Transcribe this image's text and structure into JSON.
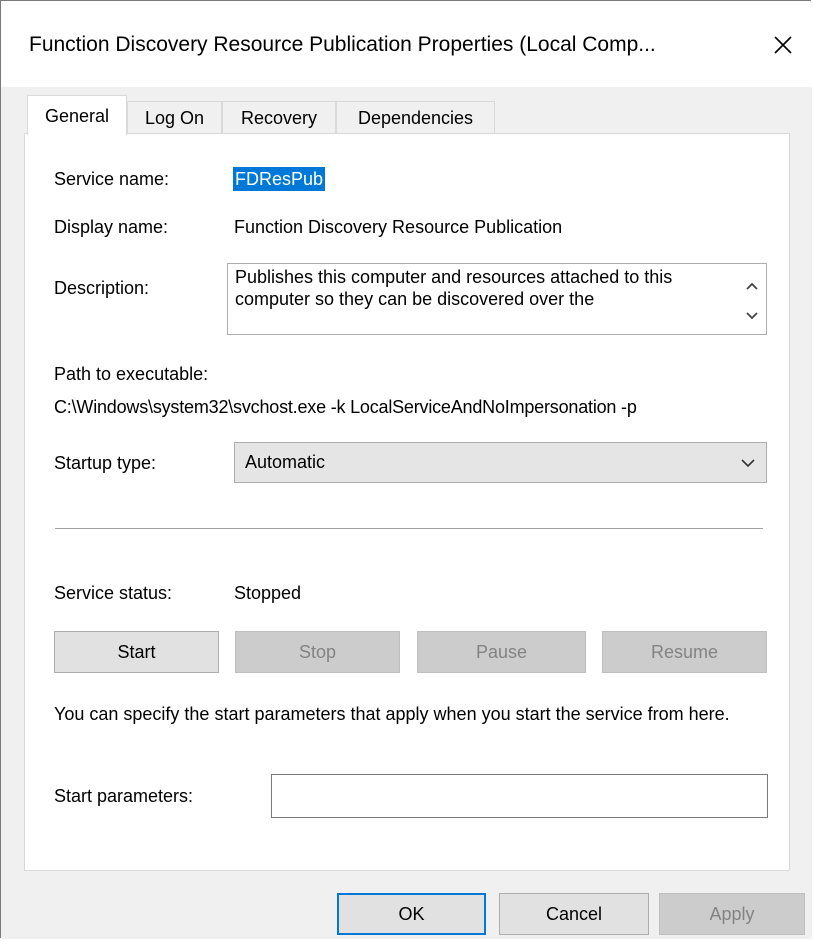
{
  "window": {
    "title": "Function Discovery Resource Publication Properties (Local Comp...",
    "close_icon": "close-icon"
  },
  "tabs": [
    {
      "label": "General",
      "active": true
    },
    {
      "label": "Log On",
      "active": false
    },
    {
      "label": "Recovery",
      "active": false
    },
    {
      "label": "Dependencies",
      "active": false
    }
  ],
  "general": {
    "service_name_label": "Service name:",
    "service_name_value": "FDResPub",
    "display_name_label": "Display name:",
    "display_name_value": "Function Discovery Resource Publication",
    "description_label": "Description:",
    "description_value": "Publishes this computer and resources attached to this computer so they can be discovered over the",
    "path_label": "Path to executable:",
    "path_value": "C:\\Windows\\system32\\svchost.exe -k LocalServiceAndNoImpersonation -p",
    "startup_type_label": "Startup type:",
    "startup_type_value": "Automatic",
    "service_status_label": "Service status:",
    "service_status_value": "Stopped",
    "buttons": {
      "start": "Start",
      "stop": "Stop",
      "pause": "Pause",
      "resume": "Resume"
    },
    "help_text": "You can specify the start parameters that apply when you start the service from here.",
    "start_params_label": "Start parameters:",
    "start_params_value": ""
  },
  "footer": {
    "ok": "OK",
    "cancel": "Cancel",
    "apply": "Apply"
  },
  "colors": {
    "selection": "#0078d7",
    "dialog_bg": "#f0f0f0",
    "disabled_text": "#838383"
  }
}
